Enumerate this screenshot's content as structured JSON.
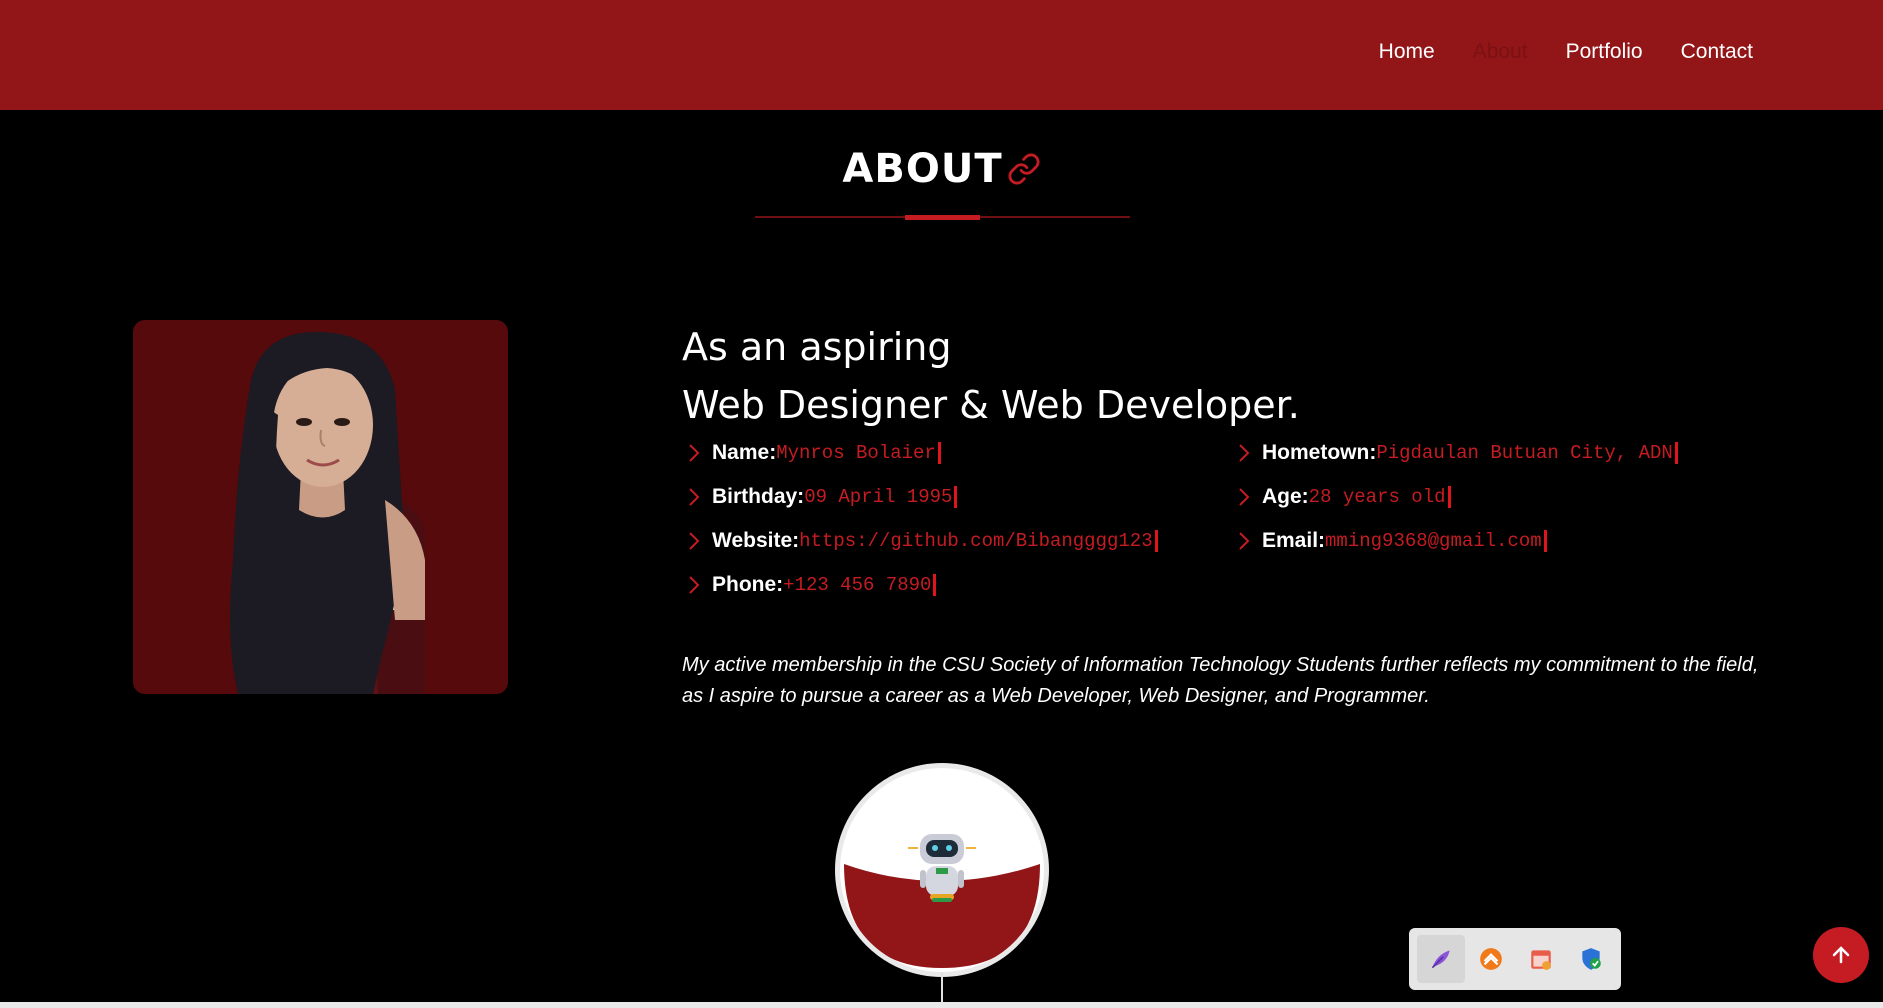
{
  "nav": {
    "items": [
      {
        "label": "Home",
        "active": false
      },
      {
        "label": "About",
        "active": true
      },
      {
        "label": "Portfolio",
        "active": false
      },
      {
        "label": "Contact",
        "active": false
      }
    ]
  },
  "section": {
    "title": "ABOUT",
    "icon": "link-icon"
  },
  "about": {
    "headline_line1": "As an aspiring",
    "headline_line2": "Web Designer & Web Developer.",
    "info": [
      {
        "label": "Name:",
        "value": "Mynros Bolaier"
      },
      {
        "label": "Birthday:",
        "value": "09 April 1995"
      },
      {
        "label": "Website:",
        "value": "https://github.com/Bibangggg123"
      },
      {
        "label": "Phone:",
        "value": "+123 456 7890"
      },
      {
        "label": "Hometown:",
        "value": "Pigdaulan Butuan City, ADN"
      },
      {
        "label": "Age:",
        "value": "28 years old"
      },
      {
        "label": "Email:",
        "value": "mming9368@gmail.com"
      }
    ],
    "description": "My active membership in the CSU Society of Information Technology Students further reflects my commitment to the field, as I aspire to pursue a career as a Web Developer, Web Designer, and Programmer."
  },
  "colors": {
    "header": "#921518",
    "accent": "#c41c22",
    "background": "#000000"
  },
  "taskbar": {
    "icons": [
      "feather-icon",
      "app-icon",
      "calendar-app-icon",
      "security-shield-icon"
    ]
  },
  "scroll_top_icon": "arrow-up-icon"
}
